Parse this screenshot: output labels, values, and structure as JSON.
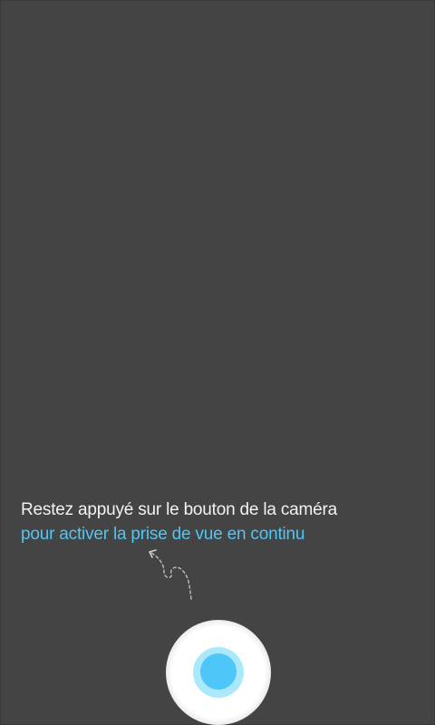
{
  "hint": {
    "line1": "Restez appuyé sur le bouton de la caméra",
    "line2": "pour activer la prise de vue en continu"
  },
  "colors": {
    "background": "#444444",
    "text_primary": "#f2f2f2",
    "text_accent": "#4fc6f5",
    "shutter_core": "#4ec6f8",
    "shutter_ring": "#a9e9fb",
    "shutter_glow": "#ffffff"
  },
  "icons": {
    "arrow": "curly-dashed-arrow-icon",
    "shutter": "camera-shutter-button"
  }
}
